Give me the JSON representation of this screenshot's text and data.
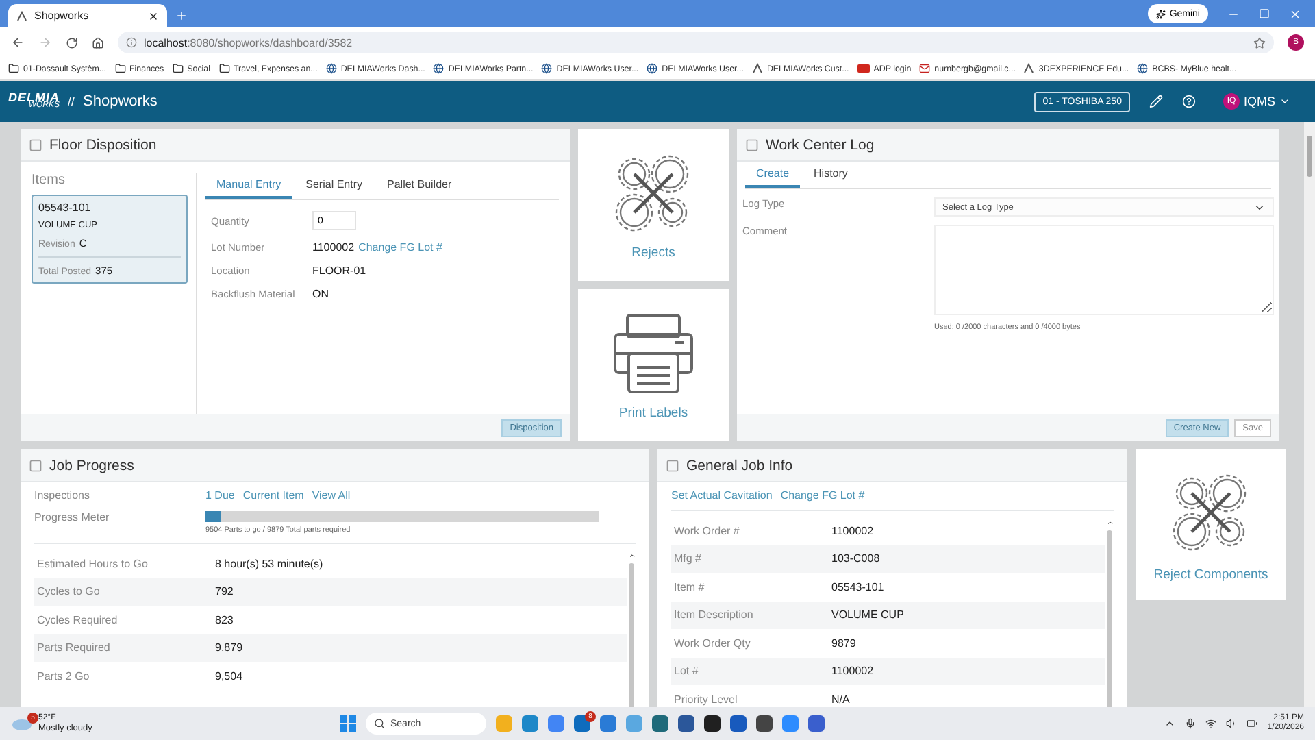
{
  "browser": {
    "tab_title": "Shopworks",
    "url_host": "localhost",
    "url_path": ":8080/shopworks/dashboard/3582",
    "gemini": "Gemini",
    "profile": "B",
    "bookmarks": [
      {
        "kind": "folder",
        "label": "01-Dassault Systèm..."
      },
      {
        "kind": "folder",
        "label": "Finances"
      },
      {
        "kind": "folder",
        "label": "Social"
      },
      {
        "kind": "folder",
        "label": "Travel, Expenses an..."
      },
      {
        "kind": "site",
        "label": "DELMIAWorks Dash..."
      },
      {
        "kind": "site",
        "label": "DELMIAWorks Partn..."
      },
      {
        "kind": "site",
        "label": "DELMIAWorks User..."
      },
      {
        "kind": "site",
        "label": "DELMIAWorks User..."
      },
      {
        "kind": "logo",
        "label": "DELMIAWorks Cust..."
      },
      {
        "kind": "adp",
        "label": "ADP login"
      },
      {
        "kind": "mail",
        "label": "nurnbergb@gmail.c..."
      },
      {
        "kind": "logo",
        "label": "3DEXPERIENCE Edu..."
      },
      {
        "kind": "site",
        "label": "BCBS- MyBlue healt..."
      }
    ]
  },
  "app": {
    "brand": "DELMIA",
    "brand_sub": "WORKS",
    "separator": "//",
    "title": "Shopworks",
    "work_center": "01 - TOSHIBA 250",
    "user_initials": "IQ",
    "user": "IQMS"
  },
  "floor_disposition": {
    "title": "Floor Disposition",
    "items_label": "Items",
    "item": {
      "number": "05543-101",
      "description": "VOLUME CUP",
      "revision_label": "Revision",
      "revision": "C",
      "total_label": "Total Posted",
      "total": "375"
    },
    "tabs": [
      {
        "label": "Manual Entry",
        "selected": true
      },
      {
        "label": "Serial Entry",
        "selected": false
      },
      {
        "label": "Pallet Builder",
        "selected": false
      }
    ],
    "fields": [
      {
        "kind": "input",
        "label": "Quantity",
        "value": "0"
      },
      {
        "kind": "link",
        "label": "Lot Number",
        "value": "1100002",
        "link": "Change FG Lot #"
      },
      {
        "kind": "text",
        "label": "Location",
        "value": "FLOOR-01"
      },
      {
        "kind": "text",
        "label": "Backflush Material",
        "value": "ON"
      }
    ],
    "button": {
      "label": "Disposition",
      "disabled": true
    }
  },
  "tiles": [
    {
      "kind": "rejects",
      "label": "Rejects"
    },
    {
      "kind": "printer",
      "label": "Print Labels"
    }
  ],
  "work_center_log": {
    "title": "Work Center Log",
    "tabs": [
      {
        "label": "Create",
        "selected": true
      },
      {
        "label": "History",
        "selected": false
      }
    ],
    "log_type_label": "Log Type",
    "log_type_placeholder": "Select a Log Type",
    "comment_label": "Comment",
    "usage": "Used: 0 /2000 characters and 0 /4000 bytes",
    "buttons": [
      {
        "kind": "primary",
        "label": "Create New",
        "disabled": true
      },
      {
        "kind": "secondary",
        "label": "Save",
        "disabled": true
      }
    ]
  },
  "job_progress": {
    "title": "Job Progress",
    "inspections_label": "Inspections",
    "inspection_links": [
      "1 Due",
      "Current Item",
      "View All"
    ],
    "progress_label": "Progress Meter",
    "level": 0.038,
    "progress_reading": "9504 Parts to go / 9879 Total parts required",
    "rows": [
      {
        "label": "Estimated Hours to Go",
        "value": "8 hour(s) 53 minute(s)"
      },
      {
        "label": "Cycles to Go",
        "value": "792"
      },
      {
        "label": "Cycles Required",
        "value": "823"
      },
      {
        "label": "Parts Required",
        "value": "9,879"
      },
      {
        "label": "Parts 2 Go",
        "value": "9,504"
      }
    ]
  },
  "general_job_info": {
    "title": "General Job Info",
    "links": [
      "Set Actual Cavitation",
      "Change FG Lot #"
    ],
    "rows": [
      {
        "label": "Work Order #",
        "value": "1100002"
      },
      {
        "label": "Mfg #",
        "value": "103-C008"
      },
      {
        "label": "Item #",
        "value": "05543-101"
      },
      {
        "label": "Item Description",
        "value": "VOLUME CUP"
      },
      {
        "label": "Work Order Qty",
        "value": "9879"
      },
      {
        "label": "Lot #",
        "value": "1100002"
      },
      {
        "label": "Priority Level",
        "value": "N/A"
      }
    ]
  },
  "reject_components": {
    "label": "Reject Components"
  },
  "taskbar": {
    "weather_badge": "5",
    "temperature": "52°F",
    "condition": "Mostly cloudy",
    "search": "Search",
    "browser_badge": "8",
    "time": "2:51 PM",
    "date": "1/20/2026"
  }
}
